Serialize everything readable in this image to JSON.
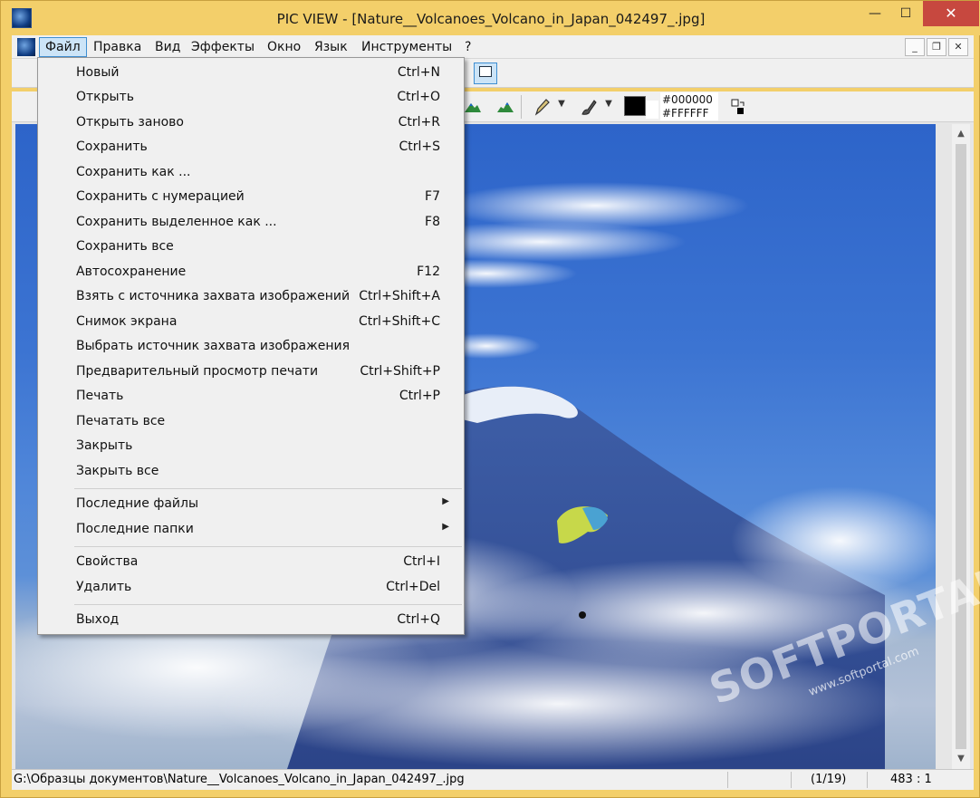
{
  "window": {
    "title": "PIC VIEW  - [Nature__Volcanoes_Volcano_in_Japan_042497_.jpg]",
    "min_glyph": "—",
    "max_glyph": "☐",
    "close_glyph": "✕"
  },
  "menubar": {
    "items": [
      "Файл",
      "Правка",
      "Вид",
      "Эффекты",
      "Окно",
      "Язык",
      "Инструменты",
      "?"
    ],
    "mdi_min": "_",
    "mdi_restore": "❐",
    "mdi_close": "✕"
  },
  "toolbar": {
    "color_fg": "#000000",
    "color_bg": "#FFFFFF"
  },
  "file_menu": {
    "items": [
      {
        "label": "Новый",
        "shortcut": "Ctrl+N"
      },
      {
        "label": "Открыть",
        "shortcut": "Ctrl+O"
      },
      {
        "label": "Открыть заново",
        "shortcut": "Ctrl+R"
      },
      {
        "label": "Сохранить",
        "shortcut": "Ctrl+S"
      },
      {
        "label": "Сохранить как ...",
        "shortcut": ""
      },
      {
        "label": "Сохранить с нумерацией",
        "shortcut": "F7"
      },
      {
        "label": "Сохранить выделенное как ...",
        "shortcut": "F8"
      },
      {
        "label": "Сохранить все",
        "shortcut": ""
      },
      {
        "label": "Автосохранение",
        "shortcut": "F12"
      },
      {
        "label": "Взять с источника захвата изображений",
        "shortcut": "Ctrl+Shift+A"
      },
      {
        "label": "Снимок экрана",
        "shortcut": "Ctrl+Shift+C"
      },
      {
        "label": "Выбрать источник захвата изображения",
        "shortcut": ""
      },
      {
        "label": "Предварительный просмотр печати",
        "shortcut": "Ctrl+Shift+P"
      },
      {
        "label": "Печать",
        "shortcut": "Ctrl+P"
      },
      {
        "label": "Печатать все",
        "shortcut": ""
      },
      {
        "label": "Закрыть",
        "shortcut": ""
      },
      {
        "label": "Закрыть все",
        "shortcut": ""
      },
      {
        "label": "Последние файлы",
        "shortcut": ""
      },
      {
        "label": "Последние папки",
        "shortcut": ""
      },
      {
        "label": "Свойства",
        "shortcut": "Ctrl+I"
      },
      {
        "label": "Удалить",
        "shortcut": "Ctrl+Del"
      },
      {
        "label": "Выход",
        "shortcut": "Ctrl+Q"
      }
    ]
  },
  "statusbar": {
    "path": "G:\\Образцы документов\\Nature__Volcanoes_Volcano_in_Japan_042497_.jpg",
    "index": "(1/19)",
    "zoom": "483 : 1"
  },
  "watermark": {
    "brand": "SOFTPORTAL",
    "url": "www.softportal.com"
  },
  "colors": {
    "frame": "#f3cf6a",
    "close_button": "#c7483f",
    "menu_active": "#cce4f7",
    "sky": "#3c74d2"
  }
}
